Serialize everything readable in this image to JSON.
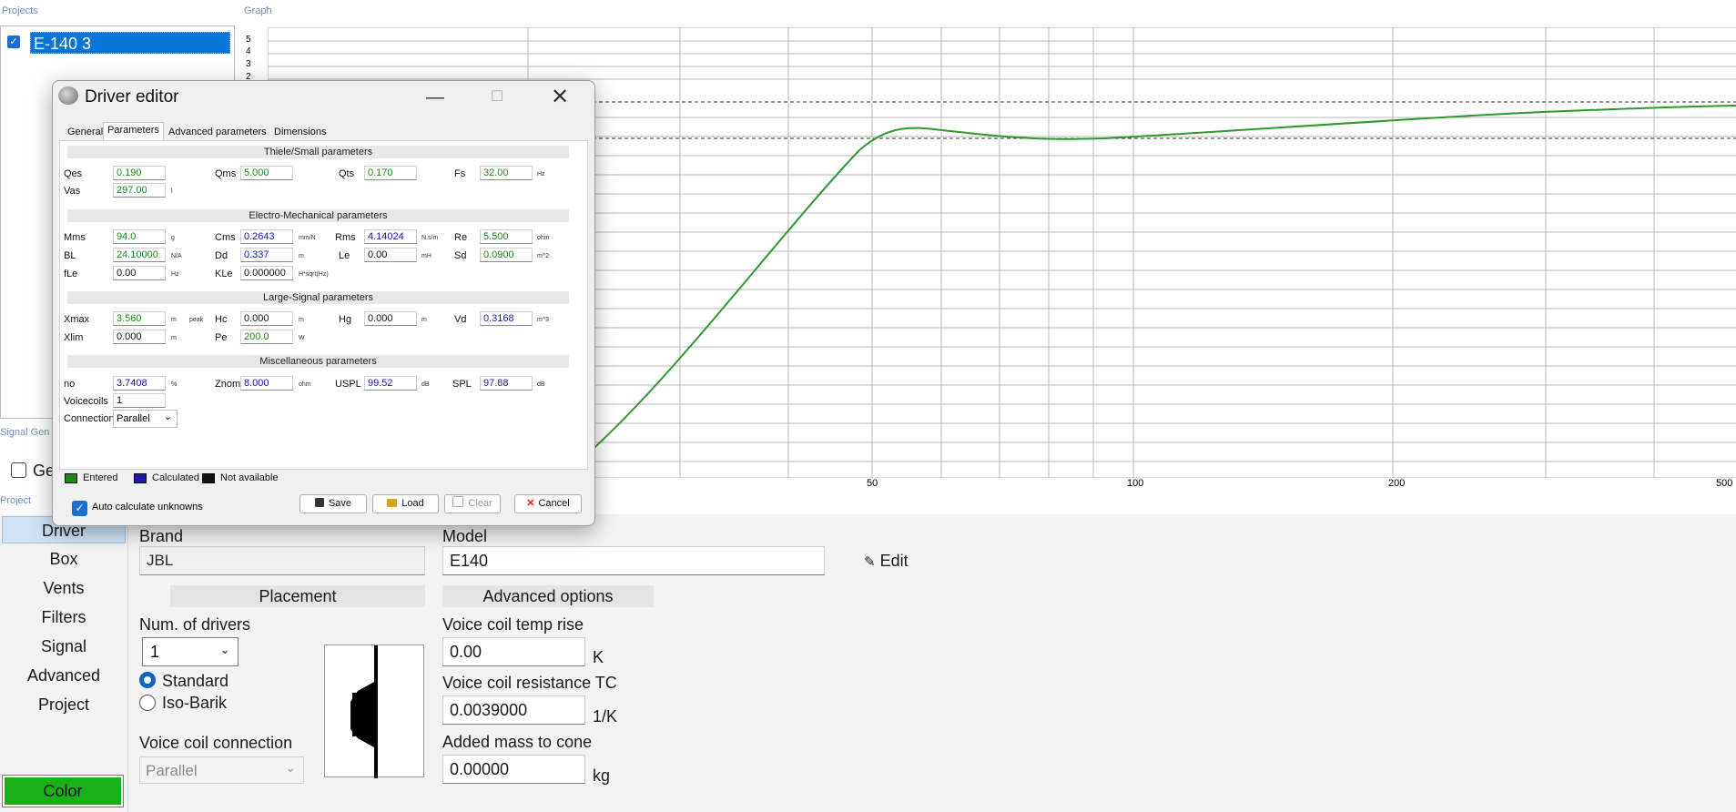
{
  "projects": {
    "label": "Projects",
    "item": "E-140 3"
  },
  "graph": {
    "label": "Graph",
    "y_ticks": [
      "5",
      "4",
      "3",
      "2"
    ],
    "x_ticks": [
      "50",
      "100",
      "200",
      "500"
    ]
  },
  "signal_gen": {
    "label": "Signal Gen",
    "checkbox_label": "Ge"
  },
  "project_label": "Project",
  "nav": [
    "Driver",
    "Box",
    "Vents",
    "Filters",
    "Signal",
    "Advanced",
    "Project"
  ],
  "color_button": "Color",
  "colors": {
    "accent": "#0a74d9",
    "entered": "#1a8a1a",
    "calculated": "#1a1ab0",
    "color_button": "#18b218",
    "curve": "#2e9a2e"
  },
  "driver": {
    "brand_label": "Brand",
    "brand": "JBL",
    "model_label": "Model",
    "model": "E140",
    "edit": "Edit",
    "placement_header": "Placement",
    "advanced_header": "Advanced options",
    "num_drivers_label": "Num. of drivers",
    "num_drivers": "1",
    "radio_standard": "Standard",
    "radio_isobarik": "Iso-Barik",
    "vc_connection_label": "Voice coil connection",
    "vc_connection": "Parallel",
    "vc_temp_label": "Voice coil temp rise",
    "vc_temp": "0.00",
    "vc_temp_unit": "K",
    "vc_tc_label": "Voice coil resistance TC",
    "vc_tc": "0.0039000",
    "vc_tc_unit": "1/K",
    "added_mass_label": "Added mass to cone",
    "added_mass": "0.00000",
    "added_mass_unit": "kg"
  },
  "dialog": {
    "title": "Driver editor",
    "tabs": [
      "General",
      "Parameters",
      "Advanced parameters",
      "Dimensions"
    ],
    "groups": [
      "Thiele/Small parameters",
      "Electro-Mechanical parameters",
      "Large-Signal parameters",
      "Miscellaneous parameters"
    ],
    "params": {
      "qes": {
        "label": "Qes",
        "value": "0.190"
      },
      "qms": {
        "label": "Qms",
        "value": "5.000"
      },
      "qts": {
        "label": "Qts",
        "value": "0.170"
      },
      "fs": {
        "label": "Fs",
        "value": "32.00",
        "unit": "Hz"
      },
      "vas": {
        "label": "Vas",
        "value": "297.00",
        "unit": "l"
      },
      "mms": {
        "label": "Mms",
        "value": "94.0",
        "unit": "g"
      },
      "cms": {
        "label": "Cms",
        "value": "0.2643",
        "unit": "mm/N"
      },
      "rms": {
        "label": "Rms",
        "value": "4.14024",
        "unit": "N.s/m"
      },
      "re": {
        "label": "Re",
        "value": "5.500",
        "unit": "ohm"
      },
      "bl": {
        "label": "BL",
        "value": "24.10000",
        "unit": "N/A"
      },
      "dd": {
        "label": "Dd",
        "value": "0.337",
        "unit": "m"
      },
      "le": {
        "label": "Le",
        "value": "0.00",
        "unit": "mH"
      },
      "sd": {
        "label": "Sd",
        "value": "0.0900",
        "unit": "m^2"
      },
      "fle": {
        "label": "fLe",
        "value": "0.00",
        "unit": "Hz"
      },
      "kle": {
        "label": "KLe",
        "value": "0.000000",
        "unit": "H*sqrt(Hz)"
      },
      "xmax": {
        "label": "Xmax",
        "value": "3.560",
        "unit": "m",
        "unit2": "peak"
      },
      "hc": {
        "label": "Hc",
        "value": "0.000",
        "unit": "m"
      },
      "hg": {
        "label": "Hg",
        "value": "0.000",
        "unit": "m"
      },
      "vd": {
        "label": "Vd",
        "value": "0.3168",
        "unit": "m^3"
      },
      "xlim": {
        "label": "Xlim",
        "value": "0.000",
        "unit": "m"
      },
      "pe": {
        "label": "Pe",
        "value": "200.0",
        "unit": "W"
      },
      "no": {
        "label": "no",
        "value": "3.7408",
        "unit": "%"
      },
      "znom": {
        "label": "Znom",
        "value": "8.000",
        "unit": "ohm"
      },
      "uspl": {
        "label": "USPL",
        "value": "99.52",
        "unit": "dB"
      },
      "spl": {
        "label": "SPL",
        "value": "97.88",
        "unit": "dB"
      },
      "voicecoils": {
        "label": "Voicecoils",
        "value": "1"
      },
      "connection": {
        "label": "Connection",
        "value": "Parallel"
      }
    },
    "legend": {
      "entered": "Entered",
      "calculated": "Calculated",
      "na": "Not available"
    },
    "auto_calc": "Auto calculate unknowns",
    "buttons": {
      "save": "Save",
      "load": "Load",
      "clear": "Clear",
      "cancel": "Cancel"
    }
  }
}
